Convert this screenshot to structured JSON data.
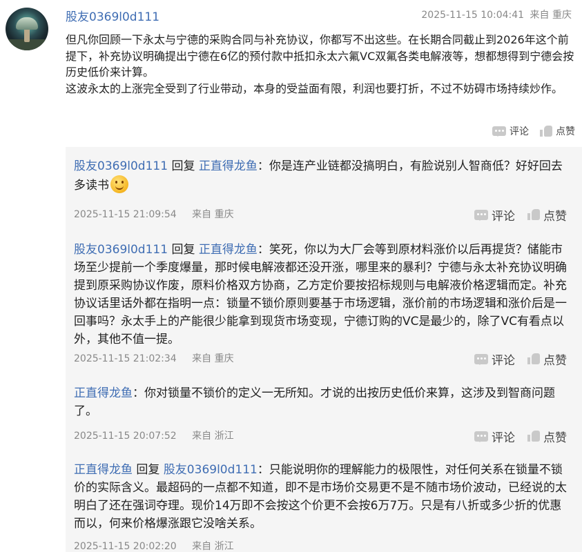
{
  "main": {
    "username": "股友0369l0d111",
    "timestamp": "2025-11-15 10:04:41",
    "source": "来自 重庆",
    "body_p1": "但凡你回顾一下永太与宁德的采购合同与补充协议，你都写不出这些。在长期合同截止到2026年这个前提下，补充协议明确提出宁德在6亿的预付款中抵扣永太六氟VC双氟各类电解液等，想都想得到宁德会按历史低价来计算。",
    "body_p2": "这波永太的上涨完全受到了行业带动，本身的受益面有限，利润也要打折，不过不妨碍市场持续炒作。",
    "comment_label": "评论",
    "like_label": "点赞"
  },
  "replies": [
    {
      "from": "股友0369l0d111",
      "reply_word": "回复",
      "to": "正直得龙鱼",
      "text": "：你是连产业链都没搞明白，有脸说别人智商低？好好回去多读书",
      "emoji": "smile-emoji",
      "time": "2025-11-15 21:09:54",
      "loc": "来自 重庆",
      "comment_label": "评论",
      "like_label": "点赞"
    },
    {
      "from": "股友0369l0d111",
      "reply_word": "回复",
      "to": "正直得龙鱼",
      "text": "：笑死，你以为大厂会等到原材料涨价以后再提货？储能市场至少提前一个季度爆量，那时候电解液都还没开涨，哪里来的暴利？宁德与永太补充协议明确提到原采购协议作废，原料价格双方协商，乙方定价要按招标规则与电解液价格逻辑而定。补充协议话里话外都在指明一点：锁量不锁价原则要基于市场逻辑，涨价前的市场逻辑和涨价后是一回事吗？永太手上的产能很少能拿到现货市场变现，宁德订购的VC是最少的，除了VC有看点以外，其他不值一提。",
      "time": "2025-11-15 21:02:34",
      "loc": "来自 重庆",
      "comment_label": "评论",
      "like_label": "点赞"
    },
    {
      "from": "正直得龙鱼",
      "text": "：你对锁量不锁价的定义一无所知。才说的出按历史低价来算，这涉及到智商问题了。",
      "time": "2025-11-15 20:07:52",
      "loc": "来自 浙江",
      "comment_label": "评论",
      "like_label": "点赞"
    },
    {
      "from": "正直得龙鱼",
      "reply_word": "回复",
      "to": "股友0369l0d111",
      "text": "：只能说明你的理解能力的极限性，对任何关系在锁量不锁价的实际含义。最超码的一点都不知道，即不是市场价交易更不是不随市场价波动，已经说的太明白了还在强词夺理。现价14万即不会按这个价更不会按6万7万。只是有八折或多少折的优惠而以，何来价格爆涨跟它没啥关系。",
      "time": "2025-11-15 20:02:20",
      "loc": "来自 浙江"
    }
  ]
}
